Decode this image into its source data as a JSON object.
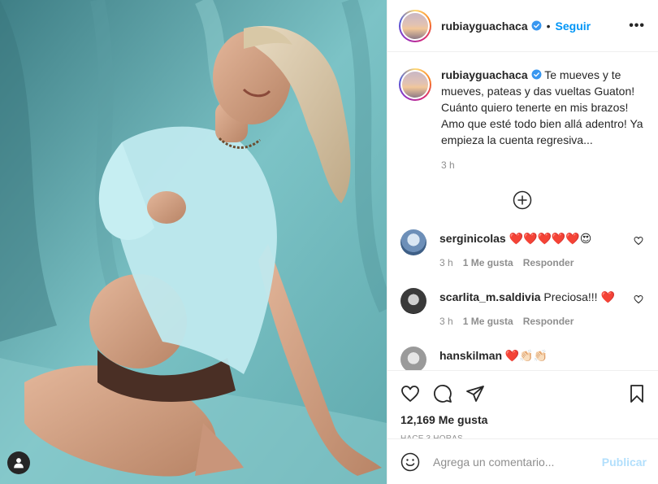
{
  "post": {
    "username": "rubiayguachaca",
    "verified": true,
    "separator": "•",
    "follow_label": "Seguir",
    "more_label": "•••",
    "caption": "Te mueves y te mueves, pateas y das vueltas Guaton! Cuánto quiero tenerte en mis brazos! Amo que esté todo bien allá adentro! Ya empieza la cuenta regresiva...",
    "caption_time": "3 h",
    "tag_icon": "person-tag-icon",
    "load_more_icon": "plus-circle-icon"
  },
  "comments": [
    {
      "username": "serginicolas",
      "text": "❤️❤️❤️❤️❤️😍",
      "time": "3 h",
      "likes": "1 Me gusta",
      "reply": "Responder",
      "avatar_color": "#6d8fb8"
    },
    {
      "username": "scarlita_m.saldivia",
      "text": "Preciosa!!! ❤️",
      "time": "3 h",
      "likes": "1 Me gusta",
      "reply": "Responder",
      "avatar_color": "#3a3a3a"
    },
    {
      "username": "hanskilman",
      "text": "❤️👏🏻👏🏻",
      "time": "",
      "likes": "",
      "reply": "",
      "avatar_color": "#9a9a9a"
    }
  ],
  "actions": {
    "likes_text": "12,169 Me gusta",
    "time_ago": "HACE 3 HORAS",
    "comment_placeholder": "Agrega un comentario...",
    "publish_label": "Publicar"
  },
  "colors": {
    "link_blue": "#0095f6",
    "publish_disabled": "#b2dffc",
    "heart_red": "#ed4956",
    "muted_text": "#8e8e8e"
  }
}
